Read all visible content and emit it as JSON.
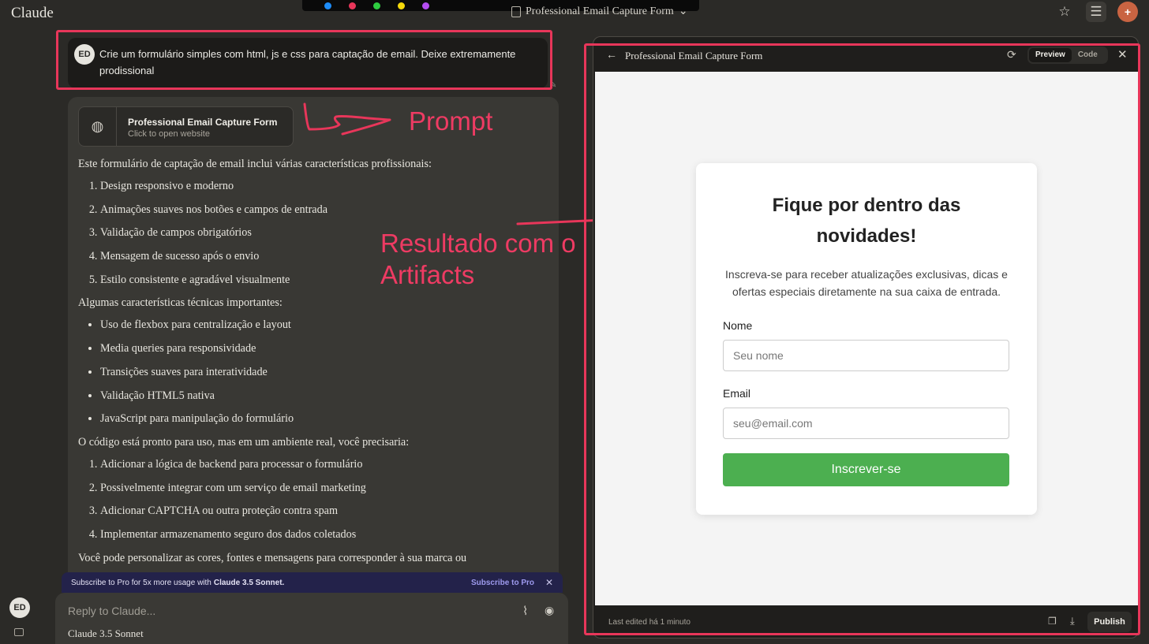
{
  "app": {
    "brand": "Claude",
    "document_title": "Professional Email Capture Form",
    "toolbar_colors": [
      "#1d8cf8",
      "#e8365a",
      "#2ecc40",
      "#f5d90a",
      "#b44df0"
    ]
  },
  "top_icons": [
    "star-icon",
    "sliders-icon",
    "new-chat-icon"
  ],
  "prompt": {
    "avatar": "ED",
    "text": "Crie um formulário simples com html, js e css para captação de email. Deixe extremamente prodissional"
  },
  "response": {
    "artifact": {
      "title": "Professional Email Capture Form",
      "subtitle": "Click to open website"
    },
    "intro": "Este formulário de captação de email inclui várias características profissionais:",
    "features": [
      "Design responsivo e moderno",
      "Animações suaves nos botões e campos de entrada",
      "Validação de campos obrigatórios",
      "Mensagem de sucesso após o envio",
      "Estilo consistente e agradável visualmente"
    ],
    "tech_intro": "Algumas características técnicas importantes:",
    "tech": [
      "Uso de flexbox para centralização e layout",
      "Media queries para responsividade",
      "Transições suaves para interatividade",
      "Validação HTML5 nativa",
      "JavaScript para manipulação do formulário"
    ],
    "ready_intro": "O código está pronto para uso, mas em um ambiente real, você precisaria:",
    "todo": [
      "Adicionar a lógica de backend para processar o formulário",
      "Possivelmente integrar com um serviço de email marketing",
      "Adicionar CAPTCHA ou outra proteção contra spam",
      "Implementar armazenamento seguro dos dados coletados"
    ],
    "closing": "Você pode personalizar as cores, fontes e mensagens para corresponder à sua marca ou"
  },
  "subscribe_banner": {
    "text": "Subscribe to Pro for 5x more usage with",
    "model": "Claude 3.5 Sonnet.",
    "link": "Subscribe to Pro",
    "close": "✕"
  },
  "reply": {
    "placeholder": "Reply to Claude...",
    "model": "Claude 3.5 Sonnet"
  },
  "sidebar": {
    "avatar": "ED"
  },
  "annotations": {
    "prompt_label": "Prompt",
    "result_label_line1": "Resultado com o",
    "result_label_line2": "Artifacts",
    "color": "#e8365a"
  },
  "artifact_panel": {
    "title": "Professional Email Capture Form",
    "tabs": [
      "Preview",
      "Code"
    ],
    "active_tab": "Preview",
    "close": "✕",
    "form": {
      "heading": "Fique por dentro das novidades!",
      "description": "Inscreva-se para receber atualizações exclusivas, dicas e ofertas especiais diretamente na sua caixa de entrada.",
      "name_label": "Nome",
      "name_placeholder": "Seu nome",
      "email_label": "Email",
      "email_placeholder": "seu@email.com",
      "submit": "Inscrever-se",
      "button_color": "#4caf50"
    },
    "footer": {
      "edited": "Last edited há 1 minuto",
      "publish": "Publish"
    }
  }
}
